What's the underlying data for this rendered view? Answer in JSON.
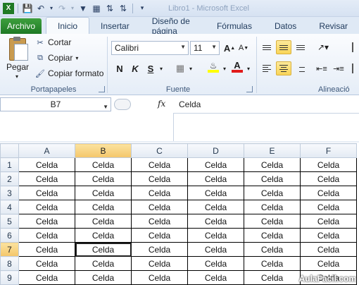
{
  "window_title": "Libro1 - Microsoft Excel",
  "tabs": [
    "Archivo",
    "Inicio",
    "Insertar",
    "Diseño de página",
    "Fórmulas",
    "Datos",
    "Revisar"
  ],
  "clipboard": {
    "paste_label": "Pegar",
    "cut_label": "Cortar",
    "copy_label": "Copiar",
    "format_painter_label": "Copiar formato",
    "group_label": "Portapapeles"
  },
  "font": {
    "name": "Calibri",
    "size": "11",
    "group_label": "Fuente",
    "bold": "N",
    "italic": "K",
    "underline": "S"
  },
  "alignment": {
    "group_label": "Alineació"
  },
  "formula_bar": {
    "name_box": "B7",
    "fx": "fx",
    "value": "Celda"
  },
  "sheet": {
    "columns": [
      "A",
      "B",
      "C",
      "D",
      "E",
      "F"
    ],
    "rows": [
      "1",
      "2",
      "3",
      "4",
      "5",
      "6",
      "7",
      "8",
      "9"
    ],
    "cell_text": "Celda",
    "selected_column": "B",
    "selected_row": "7"
  },
  "watermark": "AulaFacil.com",
  "colors": {
    "file_tab": "#2a8a2e",
    "selection_header": "#f6c96c",
    "highlight_button": "#f9d558",
    "font_color": "#e11b1b"
  }
}
